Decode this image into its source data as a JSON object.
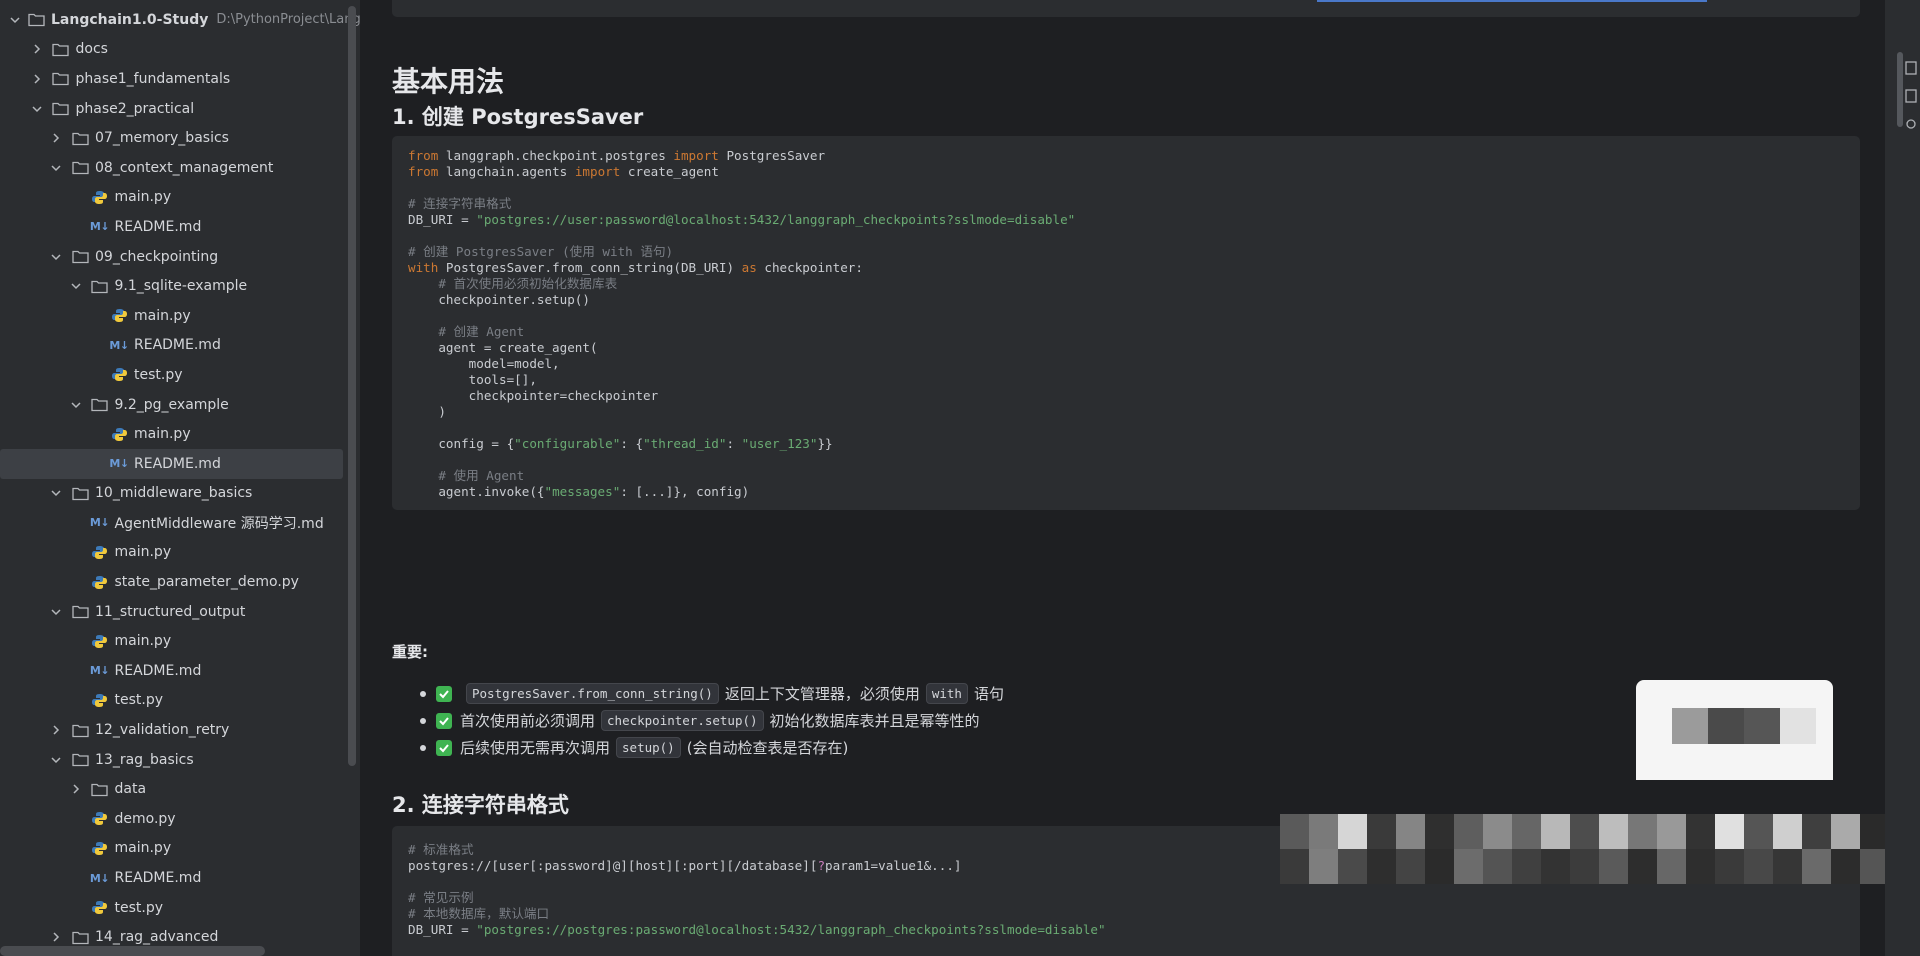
{
  "sidebar": {
    "project_name": "Langchain1.0-Study",
    "project_path": "D:\\PythonProject\\Langchai",
    "items": [
      {
        "label": "docs",
        "type": "folder",
        "depth": 1,
        "expanded": false
      },
      {
        "label": "phase1_fundamentals",
        "type": "folder",
        "depth": 1,
        "expanded": false
      },
      {
        "label": "phase2_practical",
        "type": "folder",
        "depth": 1,
        "expanded": true
      },
      {
        "label": "07_memory_basics",
        "type": "folder",
        "depth": 2,
        "expanded": false
      },
      {
        "label": "08_context_management",
        "type": "folder",
        "depth": 2,
        "expanded": true
      },
      {
        "label": "main.py",
        "type": "py",
        "depth": 3
      },
      {
        "label": "README.md",
        "type": "md",
        "depth": 3
      },
      {
        "label": "09_checkpointing",
        "type": "folder",
        "depth": 2,
        "expanded": true
      },
      {
        "label": "9.1_sqlite-example",
        "type": "folder",
        "depth": 3,
        "expanded": true
      },
      {
        "label": "main.py",
        "type": "py",
        "depth": 4
      },
      {
        "label": "README.md",
        "type": "md",
        "depth": 4
      },
      {
        "label": "test.py",
        "type": "py",
        "depth": 4
      },
      {
        "label": "9.2_pg_example",
        "type": "folder",
        "depth": 3,
        "expanded": true
      },
      {
        "label": "main.py",
        "type": "py",
        "depth": 4
      },
      {
        "label": "README.md",
        "type": "md",
        "depth": 4,
        "selected": true
      },
      {
        "label": "10_middleware_basics",
        "type": "folder",
        "depth": 2,
        "expanded": true
      },
      {
        "label": "AgentMiddleware 源码学习.md",
        "type": "md",
        "depth": 3
      },
      {
        "label": "main.py",
        "type": "py",
        "depth": 3
      },
      {
        "label": "state_parameter_demo.py",
        "type": "py",
        "depth": 3
      },
      {
        "label": "11_structured_output",
        "type": "folder",
        "depth": 2,
        "expanded": true
      },
      {
        "label": "main.py",
        "type": "py",
        "depth": 3
      },
      {
        "label": "README.md",
        "type": "md",
        "depth": 3
      },
      {
        "label": "test.py",
        "type": "py",
        "depth": 3
      },
      {
        "label": "12_validation_retry",
        "type": "folder",
        "depth": 2,
        "expanded": false
      },
      {
        "label": "13_rag_basics",
        "type": "folder",
        "depth": 2,
        "expanded": true
      },
      {
        "label": "data",
        "type": "folder",
        "depth": 3,
        "expanded": false
      },
      {
        "label": "demo.py",
        "type": "py",
        "depth": 3
      },
      {
        "label": "main.py",
        "type": "py",
        "depth": 3
      },
      {
        "label": "README.md",
        "type": "md",
        "depth": 3
      },
      {
        "label": "test.py",
        "type": "py",
        "depth": 3
      },
      {
        "label": "14_rag_advanced",
        "type": "folder",
        "depth": 2,
        "expanded": false
      }
    ],
    "md_icon_text": "M↓"
  },
  "content": {
    "section_title": "基本用法",
    "sub1_title": "1. 创建 PostgresSaver",
    "code1": {
      "l1_kw1": "from",
      "l1_mod": " langgraph.checkpoint.postgres ",
      "l1_kw2": "import",
      "l1_name": " PostgresSaver",
      "l2_kw1": "from",
      "l2_mod": " langchain.agents ",
      "l2_kw2": "import",
      "l2_name": " create_agent",
      "l4_cm": "# 连接字符串格式",
      "l5_var": "DB_URI = ",
      "l5_str": "\"postgres://user:password@localhost:5432/langgraph_checkpoints?sslmode=disable\"",
      "l7_cm": "# 创建 PostgresSaver (使用 with 语句)",
      "l8_kw": "with",
      "l8_mid": " PostgresSaver.from_conn_string(DB_URI) ",
      "l8_kw2": "as",
      "l8_end": " checkpointer:",
      "l9_cm": "    # 首次使用必须初始化数据库表",
      "l10": "    checkpointer.setup()",
      "l12_cm": "    # 创建 Agent",
      "l13": "    agent = create_agent(",
      "l14": "        model=model,",
      "l15": "        tools=[],",
      "l16": "        checkpointer=checkpointer",
      "l17": "    )",
      "l19_a": "    config = {",
      "l19_s1": "\"configurable\"",
      "l19_b": ": {",
      "l19_s2": "\"thread_id\"",
      "l19_c": ": ",
      "l19_s3": "\"user_123\"",
      "l19_d": "}}",
      "l21_cm": "    # 使用 Agent",
      "l22_a": "    agent.invoke({",
      "l22_s": "\"messages\"",
      "l22_b": ": [...]}, config)"
    },
    "important_label": "重要:",
    "bullets": [
      {
        "code": "PostgresSaver.from_conn_string()",
        "t1": "返回上下文管理器，必须使用",
        "code2": "with",
        "t2": "语句"
      },
      {
        "pre": "首次使用前必须调用",
        "code": "checkpointer.setup()",
        "t1": "初始化数据库表并且是幂等性的"
      },
      {
        "pre": "后续使用无需再次调用",
        "code": "setup()",
        "t1": "(会自动检查表是否存在)"
      }
    ],
    "sub2_title": "2. 连接字符串格式",
    "code2": {
      "l1_cm": "# 标准格式",
      "l2_a": "postgres://[user[:password]@][host][:port][/database][",
      "l2_q": "?",
      "l2_b": "param1=value1&...]",
      "l4_cm": "# 常见示例",
      "l5_cm": "# 本地数据库，默认端口",
      "l6_var": "DB_URI = ",
      "l6_str": "\"postgres://postgres:password@localhost:5432/langgraph_checkpoints?sslmode=disable\""
    }
  },
  "colors": {
    "keyword": "#cc7832",
    "string": "#6aab73",
    "comment": "#7a7e85",
    "check": "#3fb452",
    "python_blue": "#3d7ab8",
    "python_yellow": "#f0c93c"
  }
}
